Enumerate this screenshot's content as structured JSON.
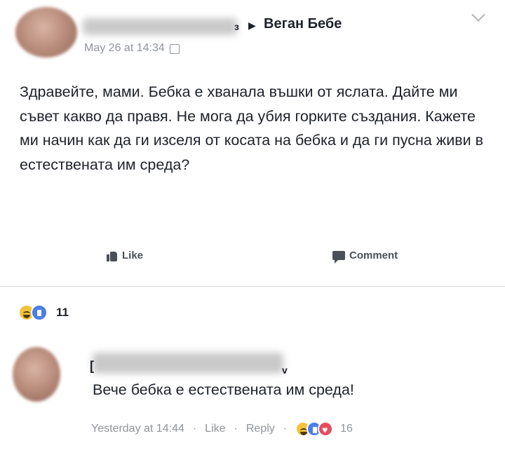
{
  "post": {
    "author_suffix": "з",
    "page_name": "Веган Бебе",
    "timestamp": "May 26 at 14:34 ·",
    "text": "Здравейте, мами. Бебка е хванала въшки от яслата. Дайте ми съвет какво да правя. Не мога да убия горките създания. Кажете ми начин как да ги изселя от косата на бебка и да ги пусна живи в естествената им среда?",
    "actions": {
      "like_label": "Like",
      "comment_label": "Comment"
    },
    "reactions": {
      "count": "11",
      "icons": [
        "haha-icon",
        "like-icon"
      ]
    }
  },
  "comment": {
    "author_marker": "[",
    "author_end": "v",
    "text": "Вече бебка е естествената им среда!",
    "timestamp": "Yesterday at 14:44",
    "like_label": "Like",
    "reply_label": "Reply",
    "separator": "·",
    "reaction_count": "16",
    "reaction_icons": [
      "haha-icon",
      "like-icon",
      "love-icon"
    ]
  },
  "colors": {
    "text": "#1d2129",
    "meta": "#90949c",
    "like_blue": "#4a7ee8",
    "love_red": "#e94b5f",
    "haha_yellow": "#f5c33b"
  }
}
